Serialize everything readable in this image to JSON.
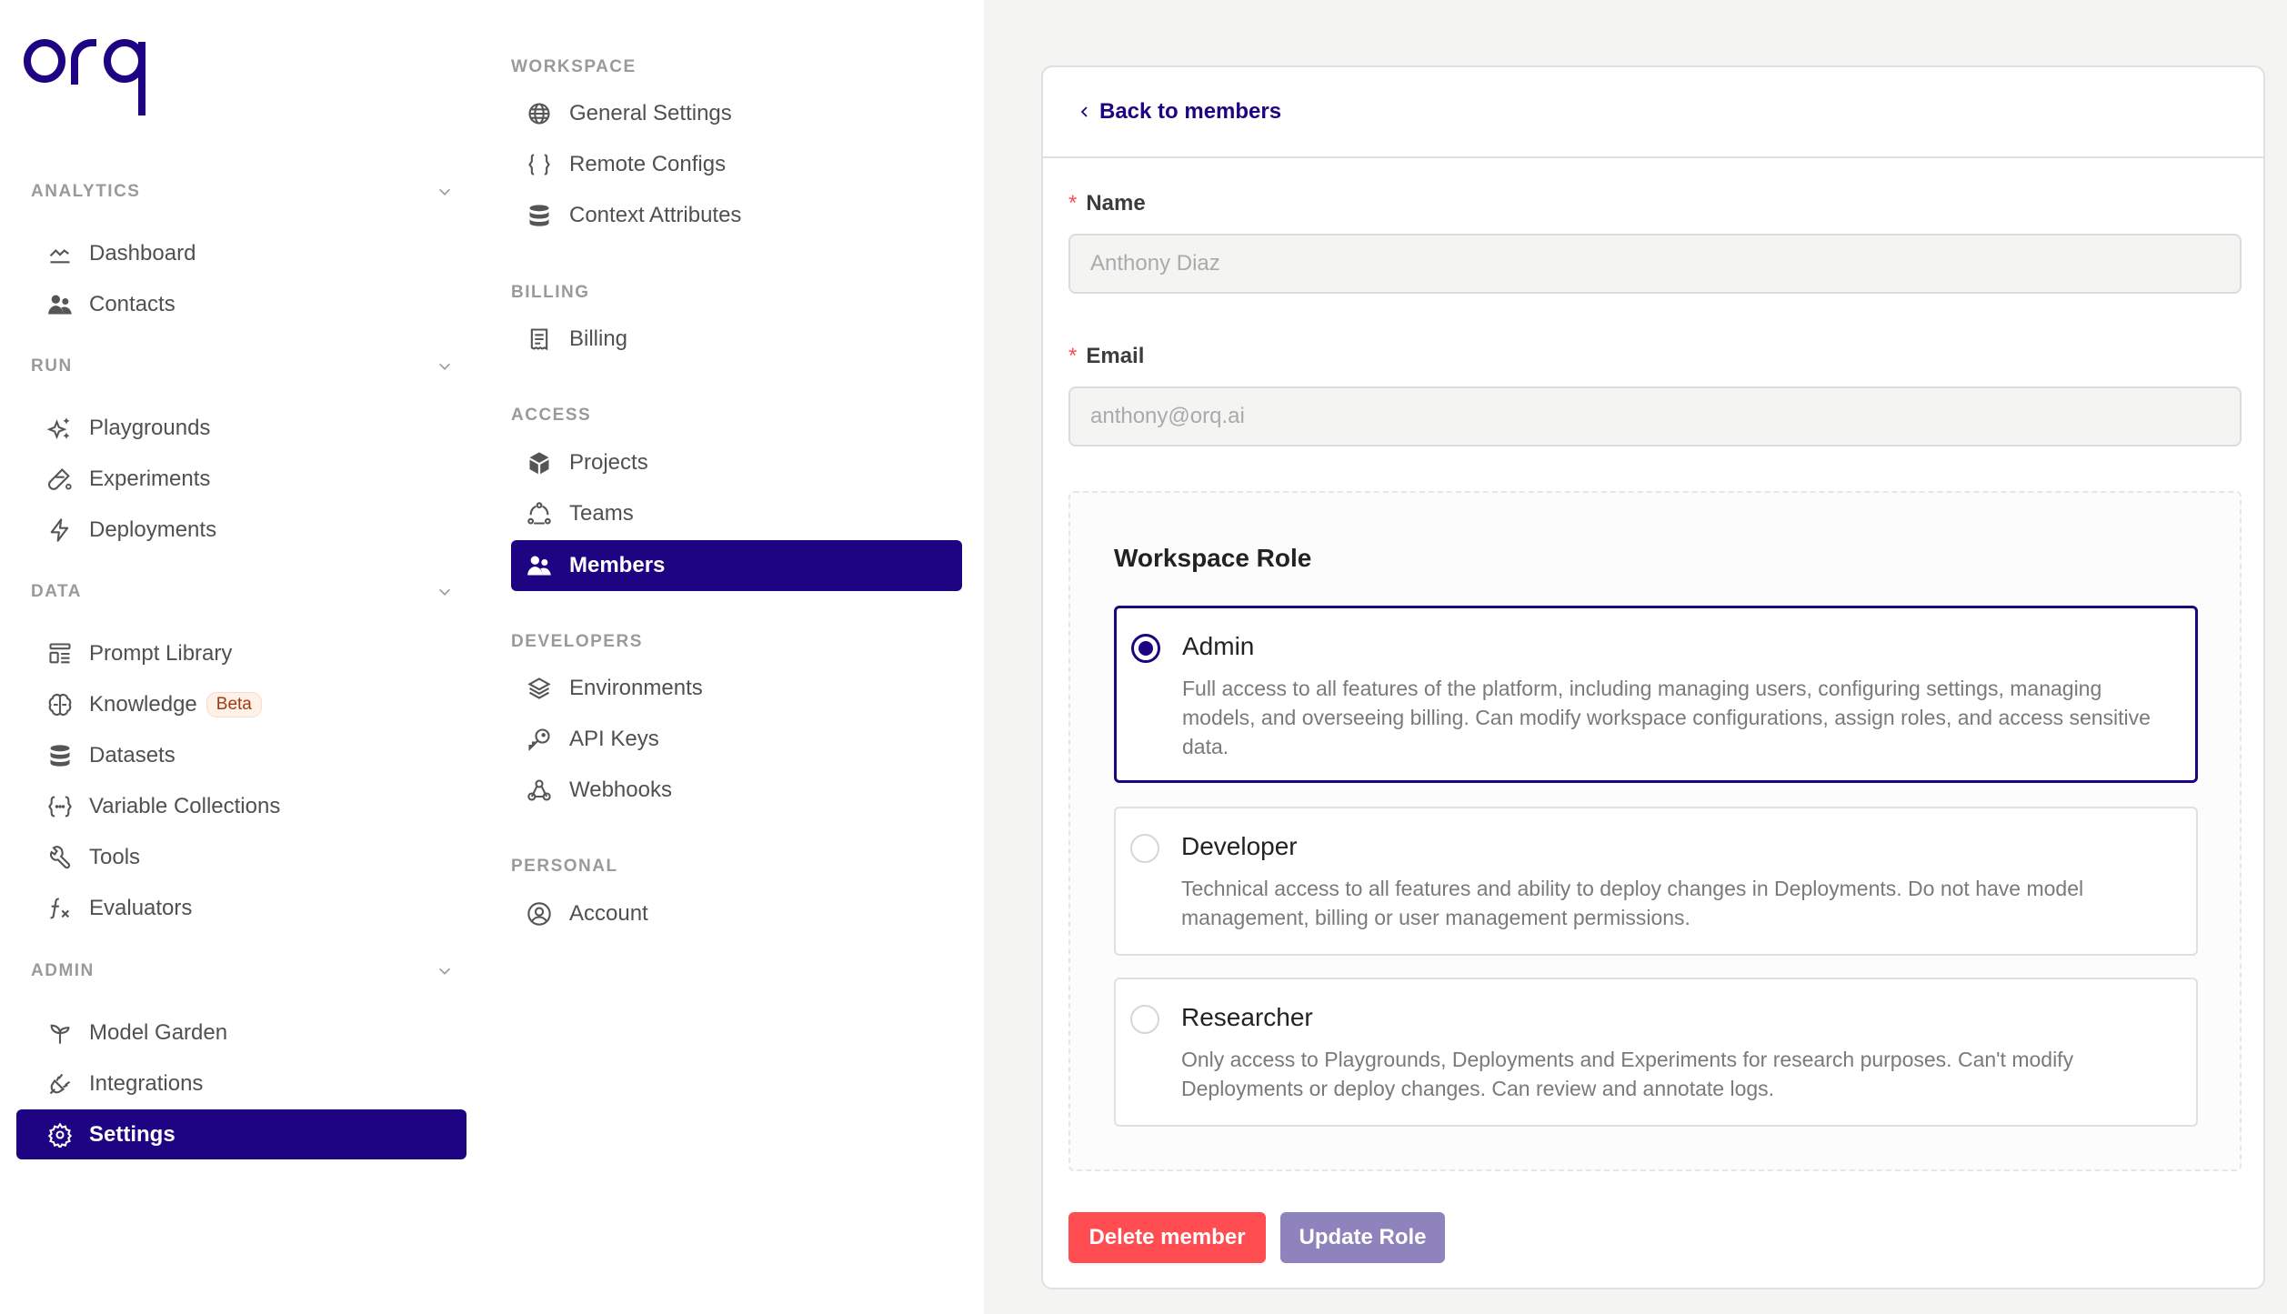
{
  "brand": {
    "logo_text": "orq",
    "accent_color": "#1e0482"
  },
  "sidebar": {
    "sections": [
      {
        "title": "ANALYTICS",
        "items": [
          {
            "label": "Dashboard",
            "icon": "chart-line-icon"
          },
          {
            "label": "Contacts",
            "icon": "users-icon"
          }
        ]
      },
      {
        "title": "RUN",
        "items": [
          {
            "label": "Playgrounds",
            "icon": "sparkles-icon"
          },
          {
            "label": "Experiments",
            "icon": "test-tube-icon"
          },
          {
            "label": "Deployments",
            "icon": "lightning-icon"
          }
        ]
      },
      {
        "title": "DATA",
        "items": [
          {
            "label": "Prompt Library",
            "icon": "layout-list-icon"
          },
          {
            "label": "Knowledge",
            "icon": "brain-icon",
            "badge": "Beta"
          },
          {
            "label": "Datasets",
            "icon": "database-icon"
          },
          {
            "label": "Variable Collections",
            "icon": "braces-dots-icon"
          },
          {
            "label": "Tools",
            "icon": "wrench-icon"
          },
          {
            "label": "Evaluators",
            "icon": "function-icon"
          }
        ]
      },
      {
        "title": "ADMIN",
        "items": [
          {
            "label": "Model Garden",
            "icon": "sprout-icon"
          },
          {
            "label": "Integrations",
            "icon": "plug-icon"
          },
          {
            "label": "Settings",
            "icon": "gear-icon",
            "active": true
          }
        ]
      }
    ]
  },
  "settings_nav": {
    "sections": [
      {
        "title": "WORKSPACE",
        "items": [
          {
            "label": "General Settings",
            "icon": "globe-icon"
          },
          {
            "label": "Remote Configs",
            "icon": "braces-icon"
          },
          {
            "label": "Context Attributes",
            "icon": "database-icon"
          }
        ]
      },
      {
        "title": "BILLING",
        "items": [
          {
            "label": "Billing",
            "icon": "receipt-icon"
          }
        ]
      },
      {
        "title": "ACCESS",
        "items": [
          {
            "label": "Projects",
            "icon": "cube-icon"
          },
          {
            "label": "Teams",
            "icon": "team-cycle-icon"
          },
          {
            "label": "Members",
            "icon": "users-icon",
            "active": true
          }
        ]
      },
      {
        "title": "DEVELOPERS",
        "items": [
          {
            "label": "Environments",
            "icon": "layers-icon"
          },
          {
            "label": "API Keys",
            "icon": "key-icon"
          },
          {
            "label": "Webhooks",
            "icon": "webhook-icon"
          }
        ]
      },
      {
        "title": "PERSONAL",
        "items": [
          {
            "label": "Account",
            "icon": "user-circle-icon"
          }
        ]
      }
    ]
  },
  "member_form": {
    "back_link": "Back to members",
    "name_label": "Name",
    "name_value": "Anthony Diaz",
    "email_label": "Email",
    "email_value": "anthony@orq.ai",
    "required_mark": "*",
    "role_title": "Workspace Role",
    "roles": [
      {
        "name": "Admin",
        "selected": true,
        "description": "Full access to all features of the platform, including managing users, configuring settings, managing models, and overseeing billing. Can modify workspace configurations, assign roles, and access sensitive data."
      },
      {
        "name": "Developer",
        "selected": false,
        "description": "Technical access to all features and ability to deploy changes in Deployments. Do not have model management, billing or user management permissions."
      },
      {
        "name": "Researcher",
        "selected": false,
        "description": "Only access to Playgrounds, Deployments and Experiments for research purposes. Can't modify Deployments or deploy changes. Can review and annotate logs."
      }
    ],
    "delete_label": "Delete member",
    "update_label": "Update Role",
    "delete_color": "#ff4d52",
    "update_color": "#8e83bd"
  }
}
